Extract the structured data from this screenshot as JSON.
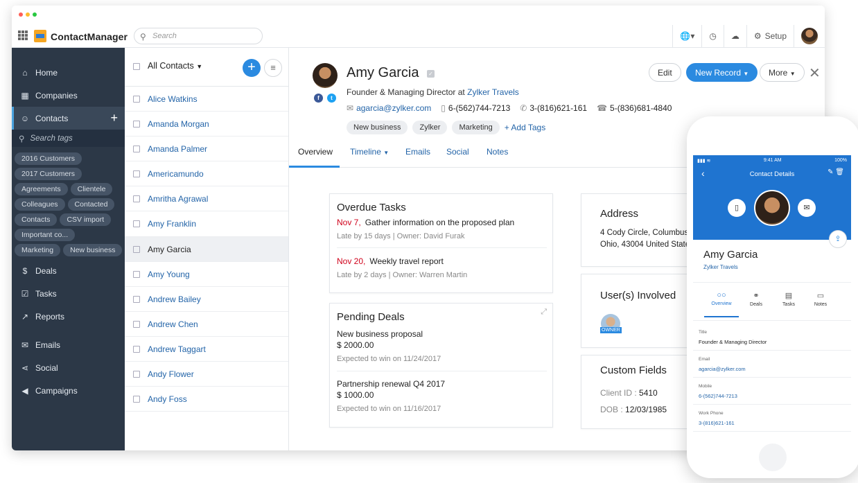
{
  "app": {
    "title": "ContactManager"
  },
  "topbar": {
    "search_placeholder": "Search",
    "setup_label": "Setup"
  },
  "sidebar": {
    "items_top": [
      {
        "label": "Home",
        "icon": "home-icon"
      },
      {
        "label": "Companies",
        "icon": "building-icon"
      },
      {
        "label": "Contacts",
        "icon": "contacts-icon"
      }
    ],
    "tag_search_placeholder": "Search tags",
    "tags": [
      "2016 Customers",
      "2017 Customers",
      "Agreements",
      "Clientele",
      "Colleagues",
      "Contacted",
      "Contacts",
      "CSV import",
      "Important co...",
      "Marketing",
      "New business"
    ],
    "items_bottom": [
      {
        "label": "Deals",
        "icon": "dollar-icon"
      },
      {
        "label": "Tasks",
        "icon": "checklist-icon"
      },
      {
        "label": "Reports",
        "icon": "chart-icon"
      },
      {
        "label": "Emails",
        "icon": "mail-icon"
      },
      {
        "label": "Social",
        "icon": "share-icon"
      },
      {
        "label": "Campaigns",
        "icon": "megaphone-icon"
      }
    ]
  },
  "contact_list": {
    "title": "All Contacts",
    "rows": [
      "Alice Watkins",
      "Amanda Morgan",
      "Amanda Palmer",
      "Americamundo",
      "Amritha Agrawal",
      "Amy Franklin",
      "Amy Garcia",
      "Amy Young",
      "Andrew Bailey",
      "Andrew Chen",
      "Andrew Taggart",
      "Andy Flower",
      "Andy Foss"
    ],
    "selected": "Amy Garcia"
  },
  "contact": {
    "name": "Amy Garcia",
    "role": "Founder & Managing Director at",
    "company": "Zylker Travels",
    "email": "agarcia@zylker.com",
    "mobile": "6-(562)744-7213",
    "work_phone": "3-(816)621-161",
    "home_phone": "5-(836)681-4840",
    "tags": [
      "New business",
      "Zylker",
      "Marketing"
    ],
    "add_tags_label": "+ Add Tags"
  },
  "actions": {
    "edit": "Edit",
    "new_record": "New Record",
    "more": "More"
  },
  "tabs": [
    "Overview",
    "Timeline",
    "Emails",
    "Social",
    "Notes"
  ],
  "overdue": {
    "title": "Overdue Tasks",
    "items": [
      {
        "date": "Nov 7,",
        "task": "Gather information on the proposed plan",
        "meta": "Late by 15 days | Owner: David Furak"
      },
      {
        "date": "Nov 20,",
        "task": "Weekly travel report",
        "meta": "Late by 2 days | Owner: Warren Martin"
      }
    ]
  },
  "pending": {
    "title": "Pending Deals",
    "items": [
      {
        "name": "New business proposal",
        "amount": "$ 2000.00",
        "meta": "Expected to win on 11/24/2017"
      },
      {
        "name": "Partnership renewal Q4 2017",
        "amount": "$ 1000.00",
        "meta": "Expected to win on 11/16/2017"
      }
    ]
  },
  "address": {
    "title": "Address",
    "line1": "4 Cody Circle, Columbus",
    "line2": "Ohio, 43004 United State"
  },
  "users": {
    "title": "User(s) Involved",
    "badge": "OWNER"
  },
  "custom": {
    "title": "Custom Fields",
    "client_label": "Client ID :",
    "client_value": "5410",
    "dob_label": "DOB :",
    "dob_value": "12/03/1985"
  },
  "mobile": {
    "time": "9:41 AM",
    "battery": "100%",
    "header": "Contact Details",
    "name": "Amy Garcia",
    "company": "Zylker Travels",
    "tabs": [
      "Overview",
      "Deals",
      "Tasks",
      "Notes"
    ],
    "fields": [
      {
        "label": "Title",
        "value": "Founder & Managing Director"
      },
      {
        "label": "Email",
        "value": "agarcia@zylker.com"
      },
      {
        "label": "Mobile",
        "value": "6-(562)744-7213"
      },
      {
        "label": "Work Phone",
        "value": "3-(816)621-161"
      }
    ]
  },
  "colors": {
    "sidebar": "#2c3847",
    "accent": "#2b8ae0",
    "mobile_header": "#1f74d0",
    "overdue": "#d0021b"
  }
}
